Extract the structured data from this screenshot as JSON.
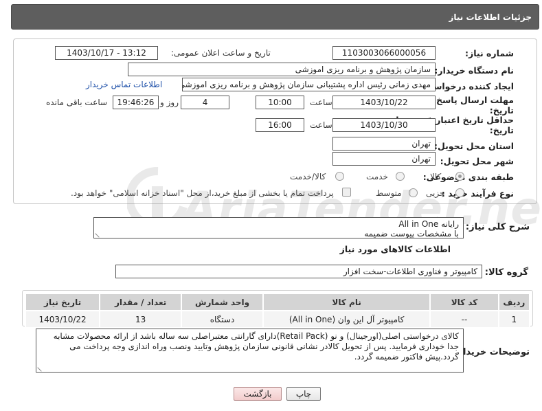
{
  "header": {
    "title": "جزئیات اطلاعات نیاز"
  },
  "form": {
    "need_number_label": "شماره نیاز:",
    "need_number": "1103003066000056",
    "announce_label": "تاریخ و ساعت اعلان عمومی:",
    "announce_value": "1403/10/17 - 13:12",
    "buyer_org_label": "نام دستگاه خریدار:",
    "buyer_org": "سازمان پژوهش و برنامه ریزی اموزشی",
    "requester_label": "ایجاد کننده درخواست:",
    "requester": "مهدی زمانی رئیس اداره پشتیبانی سازمان پژوهش و برنامه ریزی اموزشی",
    "contact_link": "اطلاعات تماس خریدار",
    "reply_deadline_label_1": "مهلت ارسال پاسخ: تا",
    "reply_deadline_label_2": "تاریخ:",
    "reply_date": "1403/10/22",
    "time_label": "ساعت",
    "reply_time": "10:00",
    "days_value": "4",
    "days_label": "روز و",
    "remaining_value": "19:46:26",
    "remaining_label": "ساعت باقی مانده",
    "validity_label_1": "حداقل تاریخ اعتبار قیمت: تا",
    "validity_label_2": "تاریخ:",
    "validity_date": "1403/10/30",
    "validity_time": "16:00",
    "province_label": "استان محل تحویل:",
    "province": "تهران",
    "city_label": "شهر محل تحویل:",
    "city": "تهران",
    "category_label": "طبقه بندی موضوعی:",
    "category_options": [
      "کالا",
      "خدمت",
      "کالا/خدمت"
    ],
    "category_selected": "کالا",
    "process_label": "نوع فرآیند خرید :",
    "process_options": [
      "جزیی",
      "متوسط"
    ],
    "process_note": "پرداخت تمام یا بخشی از مبلغ خرید،از محل \"اسناد خزانه اسلامی\" خواهد بود."
  },
  "summary": {
    "label": "شرح کلی نیاز:",
    "line1": "رایانه All in One",
    "line2": "با مشخصات پیوست ضمیمه"
  },
  "goods": {
    "section_title": "اطلاعات کالاهای مورد نیاز",
    "group_label": "گروه کالا:",
    "group_value": "کامپیوتر و فناوری اطلاعات-سخت افزار",
    "columns": [
      "ردیف",
      "کد کالا",
      "نام کالا",
      "واحد شمارش",
      "تعداد / مقدار",
      "تاریخ نیاز"
    ],
    "rows": [
      {
        "row": "1",
        "code": "--",
        "name": "کامپیوتر آل این وان (All in One)",
        "unit": "دستگاه",
        "qty": "13",
        "date": "1403/10/22"
      }
    ]
  },
  "buyer_notes": {
    "label": "توضیحات خریدار:",
    "text": "کالای درخواستی اصلی(اورجینال) و نو (Retail Pack)دارای گارانتی معتبراصلی سه ساله باشد از ارائه محصولات مشابه جدا خوداری فرمایید. پس از تحویل کالادر نشانی قانونی سازمان پژوهش وتایید ونصب وراه اندازی وجه پرداخت می گردد.پیش فاکتور ضمیمه گردد."
  },
  "buttons": {
    "print": "چاپ",
    "back": "بازگشت"
  },
  "watermark": {
    "text": "AriaTender.neT",
    "icon": "aria-logo-icon"
  }
}
